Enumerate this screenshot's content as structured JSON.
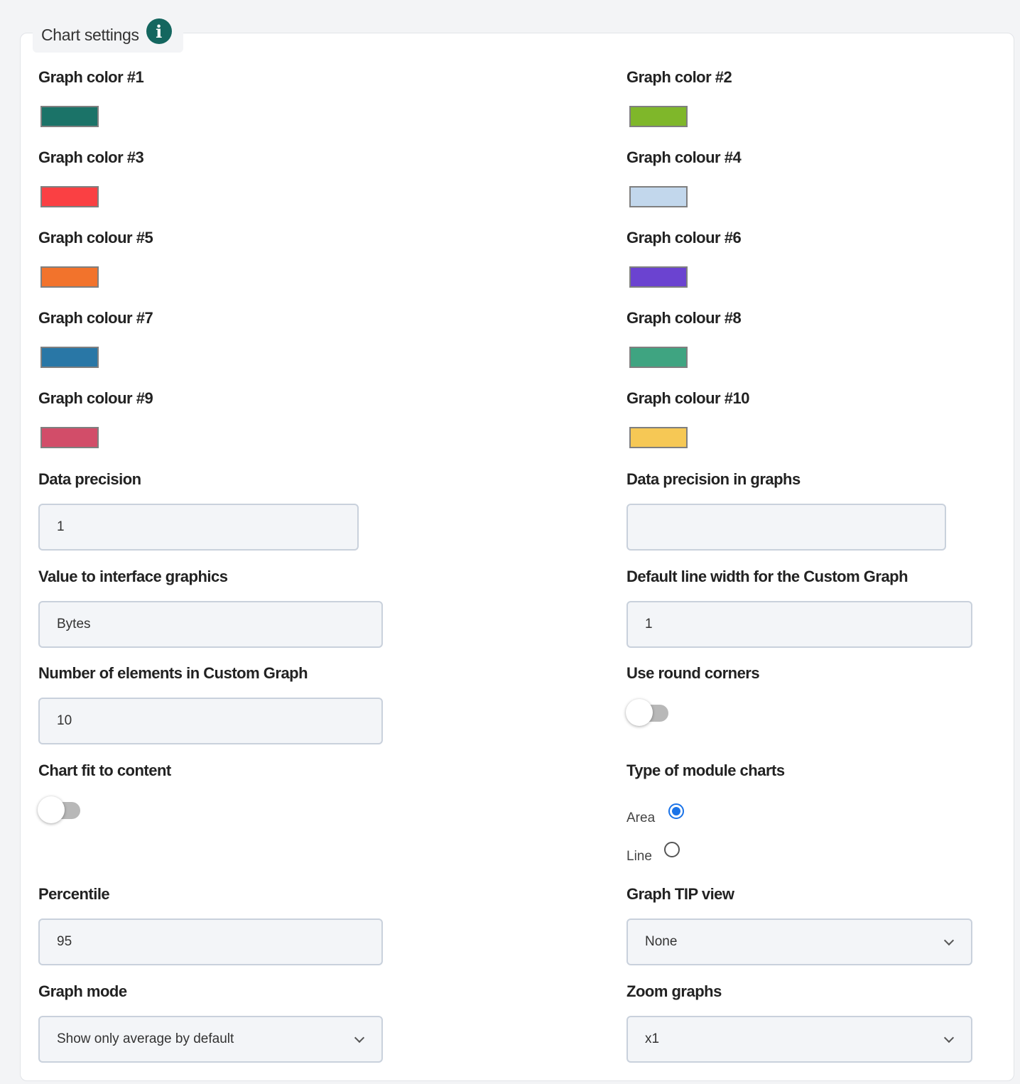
{
  "section": {
    "title": "Chart settings",
    "info_icon": "info-icon"
  },
  "colors": [
    {
      "label": "Graph color #1",
      "value": "#1b7368"
    },
    {
      "label": "Graph color #2",
      "value": "#7fb72a"
    },
    {
      "label": "Graph color #3",
      "value": "#fa4043"
    },
    {
      "label": "Graph colour #4",
      "value": "#c2d7ec"
    },
    {
      "label": "Graph colour #5",
      "value": "#f2732c"
    },
    {
      "label": "Graph colour #6",
      "value": "#6b43d0"
    },
    {
      "label": "Graph colour #7",
      "value": "#2977a6"
    },
    {
      "label": "Graph colour #8",
      "value": "#3fa481"
    },
    {
      "label": "Graph colour #9",
      "value": "#d24d69"
    },
    {
      "label": "Graph colour #10",
      "value": "#f6c855"
    }
  ],
  "fields": {
    "data_precision": {
      "label": "Data precision",
      "value": "1"
    },
    "data_precision_graphs": {
      "label": "Data precision in graphs",
      "value": ""
    },
    "value_interface": {
      "label": "Value to interface graphics",
      "value": "Bytes"
    },
    "line_width": {
      "label": "Default line width for the Custom Graph",
      "value": "1"
    },
    "num_elements": {
      "label": "Number of elements in Custom Graph",
      "value": "10"
    },
    "round_corners": {
      "label": "Use round corners",
      "checked": false
    },
    "fit_content": {
      "label": "Chart fit to content",
      "checked": false
    },
    "module_chart_type": {
      "label": "Type of module charts",
      "options": [
        {
          "label": "Area",
          "checked": true
        },
        {
          "label": "Line",
          "checked": false
        }
      ]
    },
    "percentile": {
      "label": "Percentile",
      "value": "95"
    },
    "tip_view": {
      "label": "Graph TIP view",
      "value": "None"
    },
    "graph_mode": {
      "label": "Graph mode",
      "value": "Show only average by default"
    },
    "zoom": {
      "label": "Zoom graphs",
      "value": "x1"
    }
  }
}
